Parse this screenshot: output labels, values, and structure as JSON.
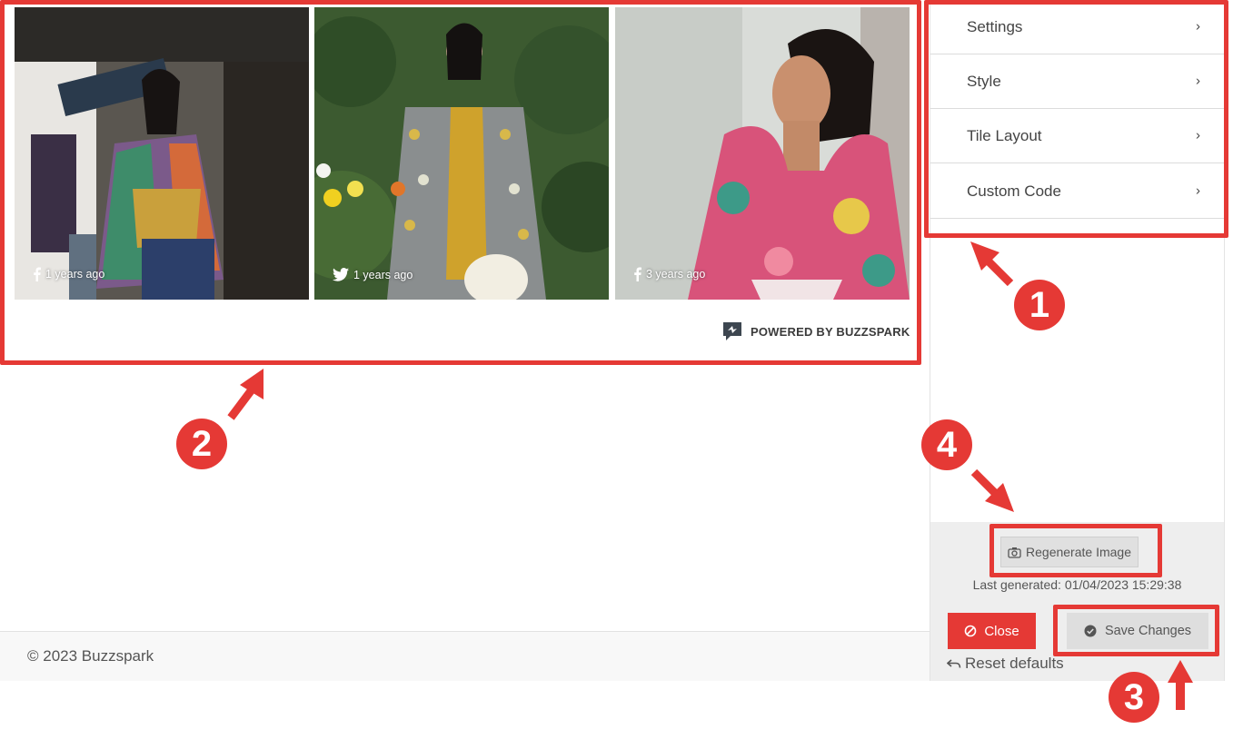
{
  "tiles": [
    {
      "network": "facebook-icon",
      "time": "1 years ago"
    },
    {
      "network": "twitter-icon",
      "time": "1 years ago"
    },
    {
      "network": "facebook-icon",
      "time": "3 years ago"
    }
  ],
  "powered_by": "POWERED BY BUZZSPARK",
  "footer": {
    "copyright": "© 2023 Buzzspark"
  },
  "panel": {
    "menu": [
      {
        "label": "Settings"
      },
      {
        "label": "Style"
      },
      {
        "label": "Tile Layout"
      },
      {
        "label": "Custom Code"
      }
    ],
    "regenerate_label": "Regenerate Image",
    "last_generated_label": "Last generated:",
    "last_generated_value": "01/04/2023 15:29:38",
    "close_label": "Close",
    "save_label": "Save Changes",
    "reset_label": "Reset defaults"
  },
  "annotations": [
    "1",
    "2",
    "3",
    "4"
  ],
  "colors": {
    "accent": "#e53935",
    "panel_bottom": "#eeeeee",
    "footer": "#f8f8f8"
  }
}
